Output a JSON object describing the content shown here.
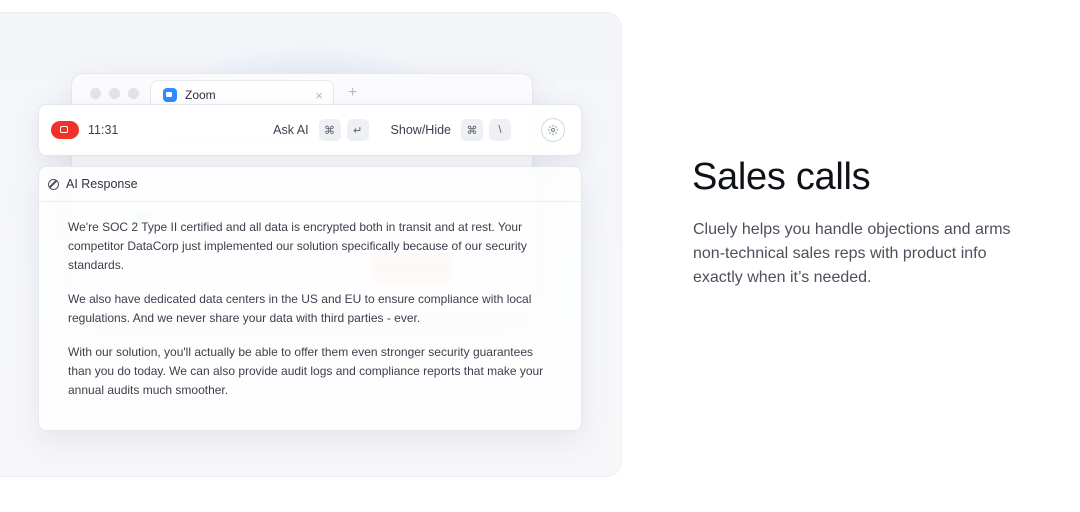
{
  "browser": {
    "tab_title": "Zoom",
    "tab_close": "×",
    "tab_plus": "+"
  },
  "controlbar": {
    "timer": "11:31",
    "ask_label": "Ask AI",
    "ask_keys": [
      "⌘",
      "↵"
    ],
    "show_label": "Show/Hide",
    "show_keys": [
      "⌘",
      "\\"
    ],
    "settings_icon": "gear-icon",
    "record_color": "#f0322b"
  },
  "response": {
    "title": "AI Response",
    "paragraphs": [
      "We're SOC 2 Type II certified and all data is encrypted both in transit and at rest. Your competitor DataCorp just implemented our solution specifically because of our security standards.",
      "We also have dedicated data centers in the US and EU to ensure compliance with local regulations. And we never share your data with third parties - ever.",
      "With our solution, you'll actually be able to offer them even stronger security guarantees than you do today. We can also provide audit logs and compliance reports that make your annual audits much smoother."
    ]
  },
  "feature": {
    "title": "Sales calls",
    "description": "Cluely helps you handle objections and arms non-technical sales reps with product info exactly when it’s needed."
  }
}
